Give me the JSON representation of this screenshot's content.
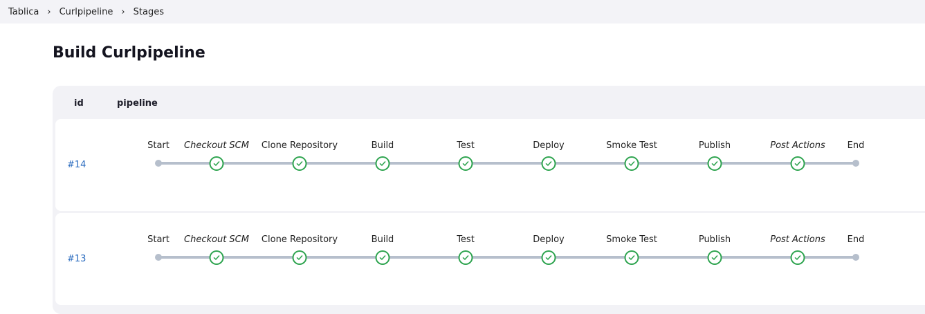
{
  "breadcrumb": [
    "Tablica",
    "Curlpipeline",
    "Stages"
  ],
  "title": "Build Curlpipeline",
  "table": {
    "headers": {
      "id": "id",
      "pipeline": "pipeline"
    },
    "stages": [
      {
        "name": "Start",
        "type": "start",
        "italic": false
      },
      {
        "name": "Checkout SCM",
        "type": "success",
        "italic": true
      },
      {
        "name": "Clone Repository",
        "type": "success",
        "italic": false
      },
      {
        "name": "Build",
        "type": "success",
        "italic": false
      },
      {
        "name": "Test",
        "type": "success",
        "italic": false
      },
      {
        "name": "Deploy",
        "type": "success",
        "italic": false
      },
      {
        "name": "Smoke Test",
        "type": "success",
        "italic": false
      },
      {
        "name": "Publish",
        "type": "success",
        "italic": false
      },
      {
        "name": "Post Actions",
        "type": "success",
        "italic": true
      },
      {
        "name": "End",
        "type": "end",
        "italic": false
      }
    ],
    "rows": [
      {
        "id": "#14"
      },
      {
        "id": "#13"
      }
    ]
  },
  "colors": {
    "success": "#2ea44f",
    "link": "#2a6bbf",
    "track": "#b6bfcc"
  }
}
